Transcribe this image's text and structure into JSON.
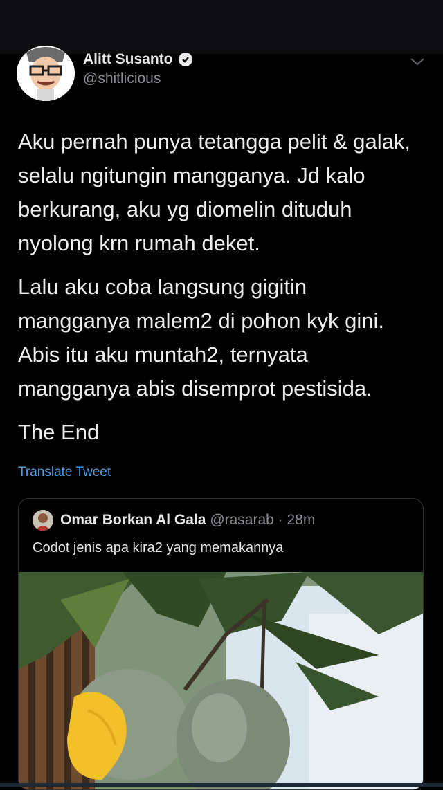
{
  "tweet": {
    "author_name": "Alitt Susanto",
    "author_handle": "@shitlicious",
    "paragraphs": [
      "Aku pernah punya tetangga pelit & galak,\nselalu ngitungin mangganya. Jd kalo\nberkurang, aku yg diomelin dituduh\nnyolong krn rumah deket.",
      "Lalu aku coba langsung gigitin\nmangganya malem2 di pohon kyk gini.\nAbis itu aku muntah2, ternyata\nmangganya abis disemprot pestisida.",
      "The End"
    ],
    "translate_label": "Translate Tweet"
  },
  "quote": {
    "author_name": "Omar Borkan Al Gala",
    "meta": "@rasarab · 28m",
    "text": "Codot jenis apa kira2 yang memakannya"
  },
  "colors": {
    "background": "#000000",
    "link": "#4aa0e8",
    "secondary_text": "#8b8f94"
  }
}
